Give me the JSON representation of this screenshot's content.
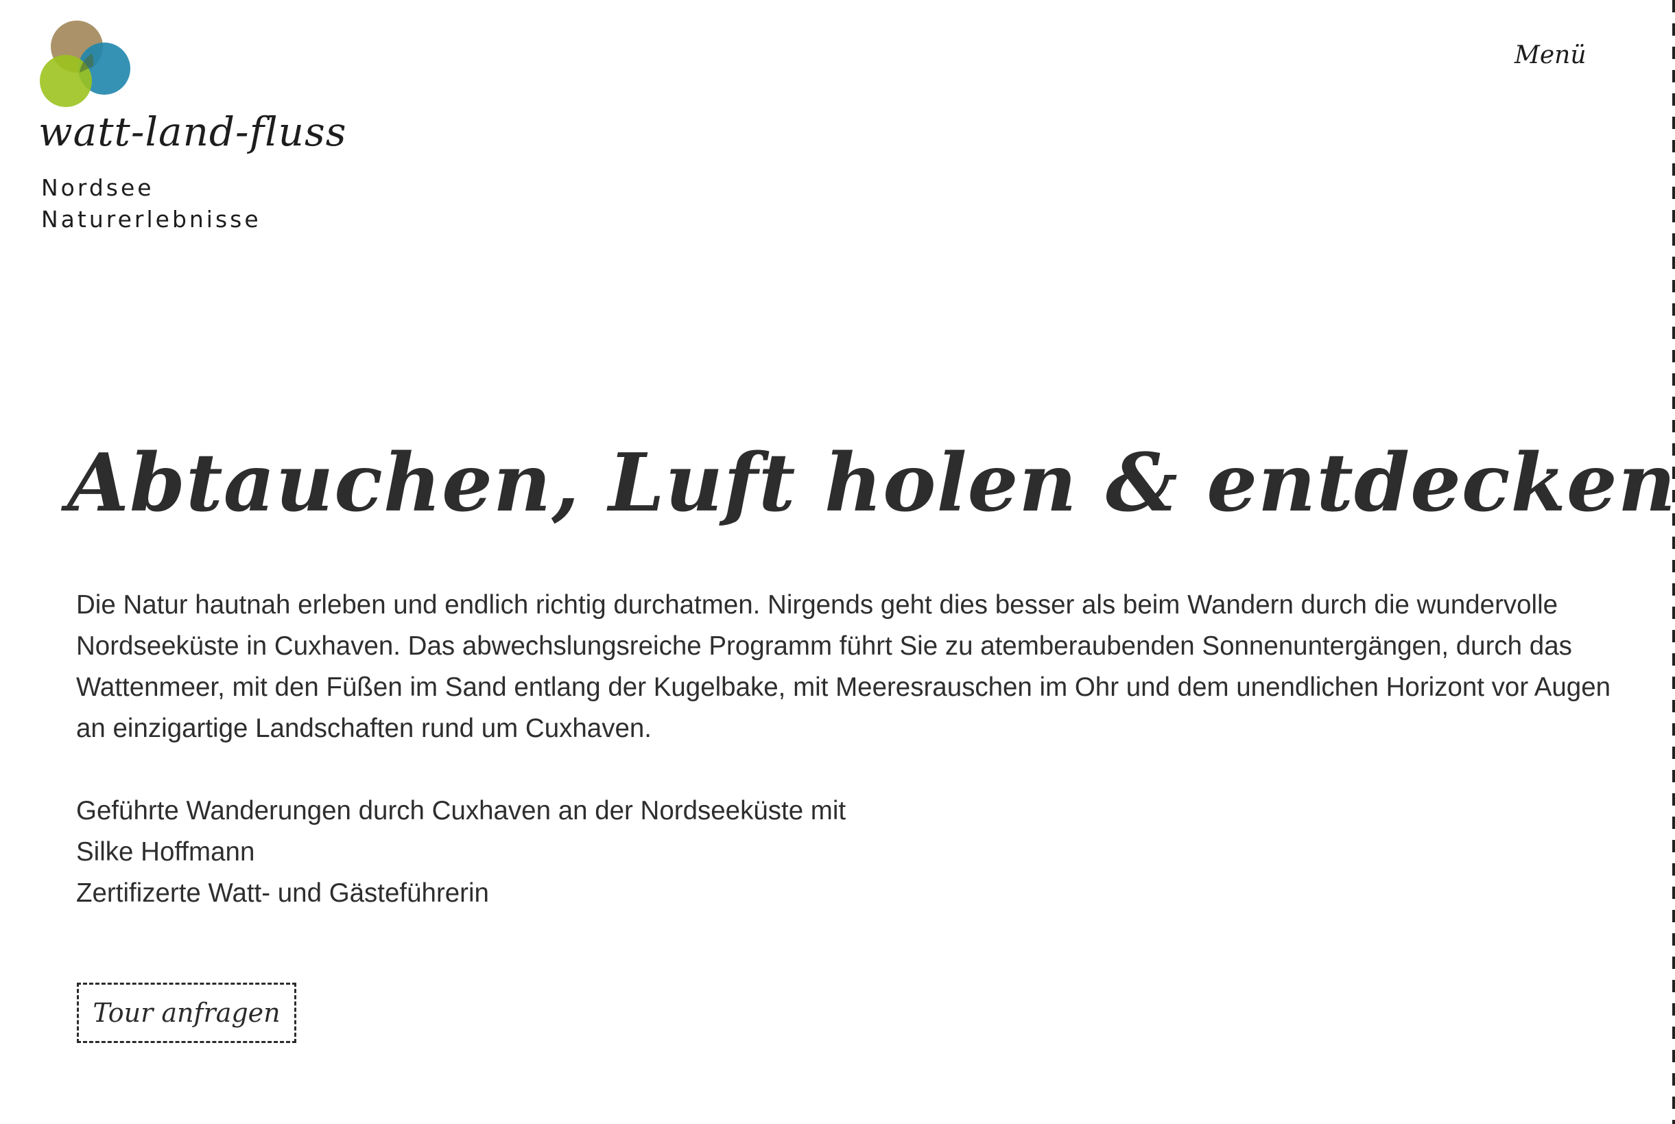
{
  "header": {
    "brand_name": "watt-land-fluss",
    "brand_sub_line1": "Nordsee",
    "brand_sub_line2": "Naturerlebnisse",
    "menu_label": "Menü",
    "logo_colors": {
      "brown": "#9c7f4e",
      "green": "#9cc31f",
      "blue": "#1f86ad"
    }
  },
  "hero": {
    "title": "Abtauchen, Luft holen & entdecken.",
    "intro": "Die Natur hautnah erleben und endlich richtig durchatmen. Nirgends geht dies besser als beim Wandern durch die wundervolle Nordseeküste in Cuxhaven. Das abwechslungsreiche Programm führt Sie zu atemberaubenden Sonnenuntergängen, durch das Wattenmeer, mit den Füßen im Sand entlang der Kugelbake, mit Meeresrauschen im Ohr und dem unendlichen Horizont vor Augen an einzigartige Landschaften rund um Cuxhaven.",
    "guide_line1": "Geführte Wanderungen durch Cuxhaven an der Nordseeküste mit",
    "guide_line2": "Silke Hoffmann",
    "guide_line3": "Zertifizerte Watt- und Gästeführerin",
    "cta_label": "Tour anfragen"
  }
}
